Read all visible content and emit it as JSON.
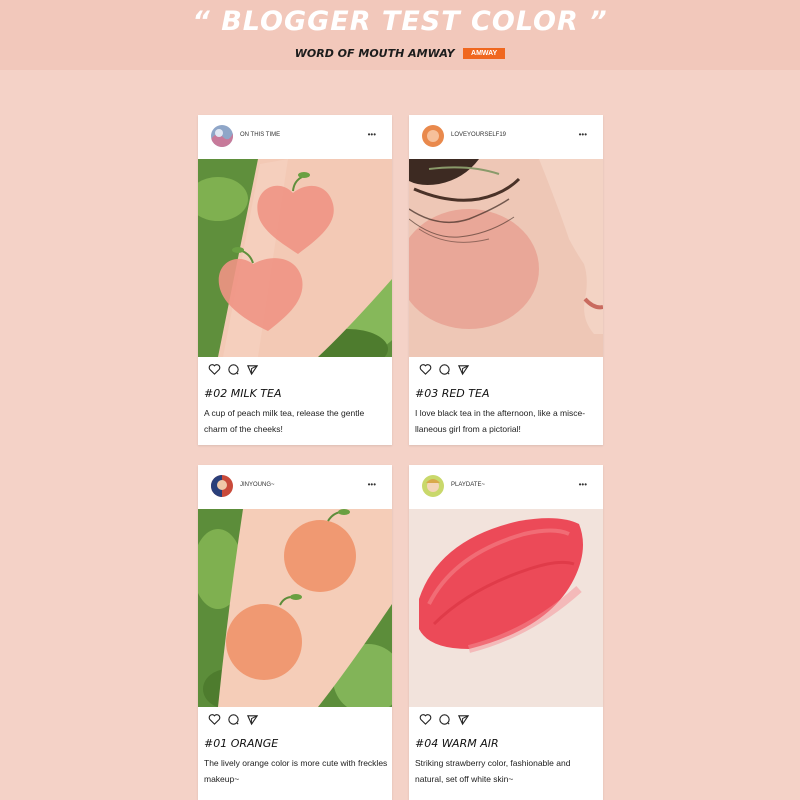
{
  "header": {
    "title": "“ BLOGGER TEST COLOR ”",
    "subtitle": "WORD OF MOUTH AMWAY",
    "badge": "AMWAY"
  },
  "posts": [
    {
      "username": "ON THIS TIME",
      "title": "#02 MILK TEA",
      "caption": "A cup of peach milk tea, release the gentle charm of the cheeks!",
      "image": "peach-swatch-on-arm-photo"
    },
    {
      "username": "LOVEYOURSELF19",
      "title": "#03 RED TEA",
      "caption": "I love black tea in the afternoon, like a misce-llaneous girl from a pictorial!",
      "image": "blush-on-cheek-photo"
    },
    {
      "username": "JINYOUNG~",
      "title": "#01 ORANGE",
      "caption": "The lively orange color is more cute with freckles makeup~",
      "image": "orange-swatch-on-arm-photo"
    },
    {
      "username": "PLAYDATE~",
      "title": "#04 WARM AIR",
      "caption": "Striking strawberry color, fashionable and natural, set off white skin~",
      "image": "strawberry-swatch-photo"
    }
  ],
  "icons": {
    "more": "more-dots-icon",
    "like": "heart-icon",
    "comment": "comment-icon",
    "share": "share-icon"
  },
  "colors": {
    "background": "#f4d2c7",
    "badge": "#f0671f",
    "title": "#ffffff"
  }
}
